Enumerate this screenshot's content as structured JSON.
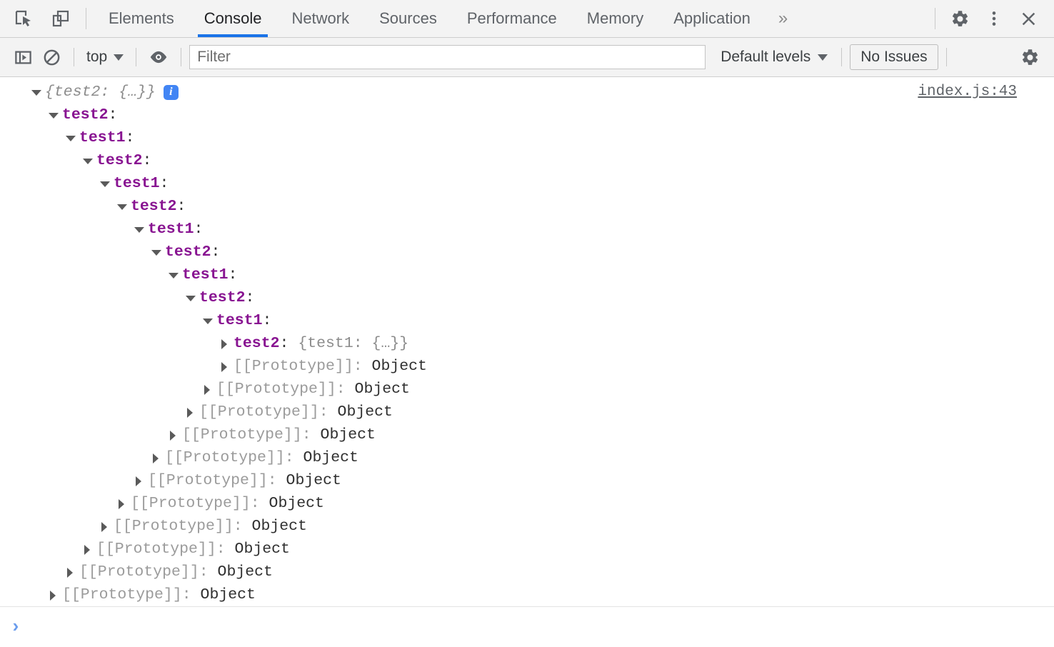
{
  "tabbar": {
    "left_icons": [
      {
        "name": "inspect-element-icon",
        "label": "Inspect element"
      },
      {
        "name": "device-toolbar-icon",
        "label": "Toggle device toolbar"
      }
    ],
    "tabs": [
      {
        "label": "Elements",
        "active": false
      },
      {
        "label": "Console",
        "active": true
      },
      {
        "label": "Network",
        "active": false
      },
      {
        "label": "Sources",
        "active": false
      },
      {
        "label": "Performance",
        "active": false
      },
      {
        "label": "Memory",
        "active": false
      },
      {
        "label": "Application",
        "active": false
      }
    ],
    "more_tabs_label": "»",
    "right_icons": [
      {
        "name": "settings-gear-icon",
        "label": "Settings"
      },
      {
        "name": "more-options-icon",
        "label": "Customize and control DevTools"
      },
      {
        "name": "close-icon",
        "label": "Close DevTools"
      }
    ]
  },
  "filterbar": {
    "sidebar_toggle_label": "Show console sidebar",
    "clear_console_label": "Clear console",
    "context_value": "top",
    "live_expression_label": "Create live expression",
    "filter_placeholder": "Filter",
    "filter_value": "",
    "levels_value": "Default levels",
    "issues_label": "No Issues",
    "settings_label": "Console settings"
  },
  "console": {
    "source_link": "index.js:43",
    "badge_letter": "i",
    "rows": [
      {
        "indent": 0,
        "arrow": "open",
        "type": "preview",
        "text": "{test2: {…}}",
        "badge": true
      },
      {
        "indent": 1,
        "arrow": "open",
        "type": "prop",
        "key": "test2",
        "punct": ":"
      },
      {
        "indent": 2,
        "arrow": "open",
        "type": "prop",
        "key": "test1",
        "punct": ":"
      },
      {
        "indent": 3,
        "arrow": "open",
        "type": "prop",
        "key": "test2",
        "punct": ":"
      },
      {
        "indent": 4,
        "arrow": "open",
        "type": "prop",
        "key": "test1",
        "punct": ":"
      },
      {
        "indent": 5,
        "arrow": "open",
        "type": "prop",
        "key": "test2",
        "punct": ":"
      },
      {
        "indent": 6,
        "arrow": "open",
        "type": "prop",
        "key": "test1",
        "punct": ":"
      },
      {
        "indent": 7,
        "arrow": "open",
        "type": "prop",
        "key": "test2",
        "punct": ":"
      },
      {
        "indent": 8,
        "arrow": "open",
        "type": "prop",
        "key": "test1",
        "punct": ":"
      },
      {
        "indent": 9,
        "arrow": "open",
        "type": "prop",
        "key": "test2",
        "punct": ":"
      },
      {
        "indent": 10,
        "arrow": "open",
        "type": "prop",
        "key": "test1",
        "punct": ":"
      },
      {
        "indent": 11,
        "arrow": "closed",
        "type": "propval",
        "key": "test2",
        "punct": ": ",
        "value": "{test1: {…}}"
      },
      {
        "indent": 11,
        "arrow": "closed",
        "type": "proto",
        "label": "[[Prototype]]",
        "punct": ": ",
        "value": "Object"
      },
      {
        "indent": 10,
        "arrow": "closed",
        "type": "proto",
        "label": "[[Prototype]]",
        "punct": ": ",
        "value": "Object"
      },
      {
        "indent": 9,
        "arrow": "closed",
        "type": "proto",
        "label": "[[Prototype]]",
        "punct": ": ",
        "value": "Object"
      },
      {
        "indent": 8,
        "arrow": "closed",
        "type": "proto",
        "label": "[[Prototype]]",
        "punct": ": ",
        "value": "Object"
      },
      {
        "indent": 7,
        "arrow": "closed",
        "type": "proto",
        "label": "[[Prototype]]",
        "punct": ": ",
        "value": "Object"
      },
      {
        "indent": 6,
        "arrow": "closed",
        "type": "proto",
        "label": "[[Prototype]]",
        "punct": ": ",
        "value": "Object"
      },
      {
        "indent": 5,
        "arrow": "closed",
        "type": "proto",
        "label": "[[Prototype]]",
        "punct": ": ",
        "value": "Object"
      },
      {
        "indent": 4,
        "arrow": "closed",
        "type": "proto",
        "label": "[[Prototype]]",
        "punct": ": ",
        "value": "Object"
      },
      {
        "indent": 3,
        "arrow": "closed",
        "type": "proto",
        "label": "[[Prototype]]",
        "punct": ": ",
        "value": "Object"
      },
      {
        "indent": 2,
        "arrow": "closed",
        "type": "proto",
        "label": "[[Prototype]]",
        "punct": ": ",
        "value": "Object"
      },
      {
        "indent": 1,
        "arrow": "closed",
        "type": "proto",
        "label": "[[Prototype]]",
        "punct": ": ",
        "value": "Object"
      }
    ]
  },
  "prompt": {
    "chevron": "›",
    "value": ""
  },
  "colors": {
    "accent": "#1a73e8",
    "property_key": "#881391",
    "preview_gray": "#8c8c8c",
    "prototype_gray": "#9b9b9b",
    "value_dark": "#303030",
    "badge_blue": "#4285f4",
    "toolbar_bg": "#f3f3f3",
    "prompt_chevron": "#6b9ded"
  }
}
